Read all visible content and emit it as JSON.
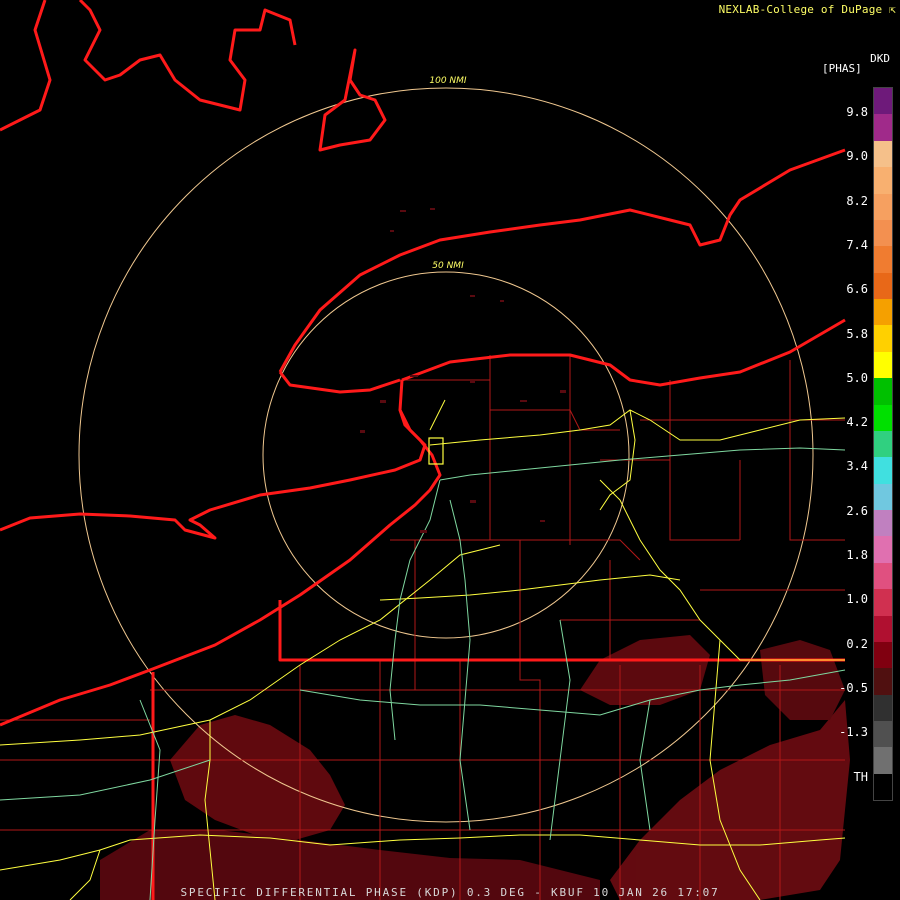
{
  "credit": "NEXLAB-College of DuPage",
  "credit_icon": "pointer-icon",
  "footer": "SPECIFIC DIFFERENTIAL PHASE (KDP) 0.3 DEG - KBUF 10 JAN 26 17:07",
  "legend": {
    "product": "DKD",
    "unit": "[PHAS]",
    "ticks": [
      "9.8",
      "9.0",
      "8.2",
      "7.4",
      "6.6",
      "5.8",
      "5.0",
      "4.2",
      "3.4",
      "2.6",
      "1.8",
      "1.0",
      "0.2",
      "-0.5",
      "-1.3",
      "TH"
    ],
    "colors": [
      "#6e1a7a",
      "#a02a8a",
      "#f5c08a",
      "#f8b070",
      "#f6a060",
      "#f39050",
      "#f07c30",
      "#e86818",
      "#f5a000",
      "#ffd000",
      "#ffff00",
      "#00c000",
      "#00e000",
      "#30d080",
      "#40e0e0",
      "#70c8e0",
      "#c080c0",
      "#e070b0",
      "#e05080",
      "#d03050",
      "#b01030",
      "#800010",
      "#501010",
      "#303030",
      "#505050",
      "#707070",
      "#000000"
    ]
  },
  "range_rings": {
    "inner_label": "50 NMI",
    "outer_label": "100 NMI"
  },
  "colors": {
    "coastline": "#ff1a1a",
    "county": "#b01818",
    "highway": "#ffff40",
    "road": "#7fd8a0",
    "ring": "#f0c890",
    "echo": "#7a0c10"
  }
}
